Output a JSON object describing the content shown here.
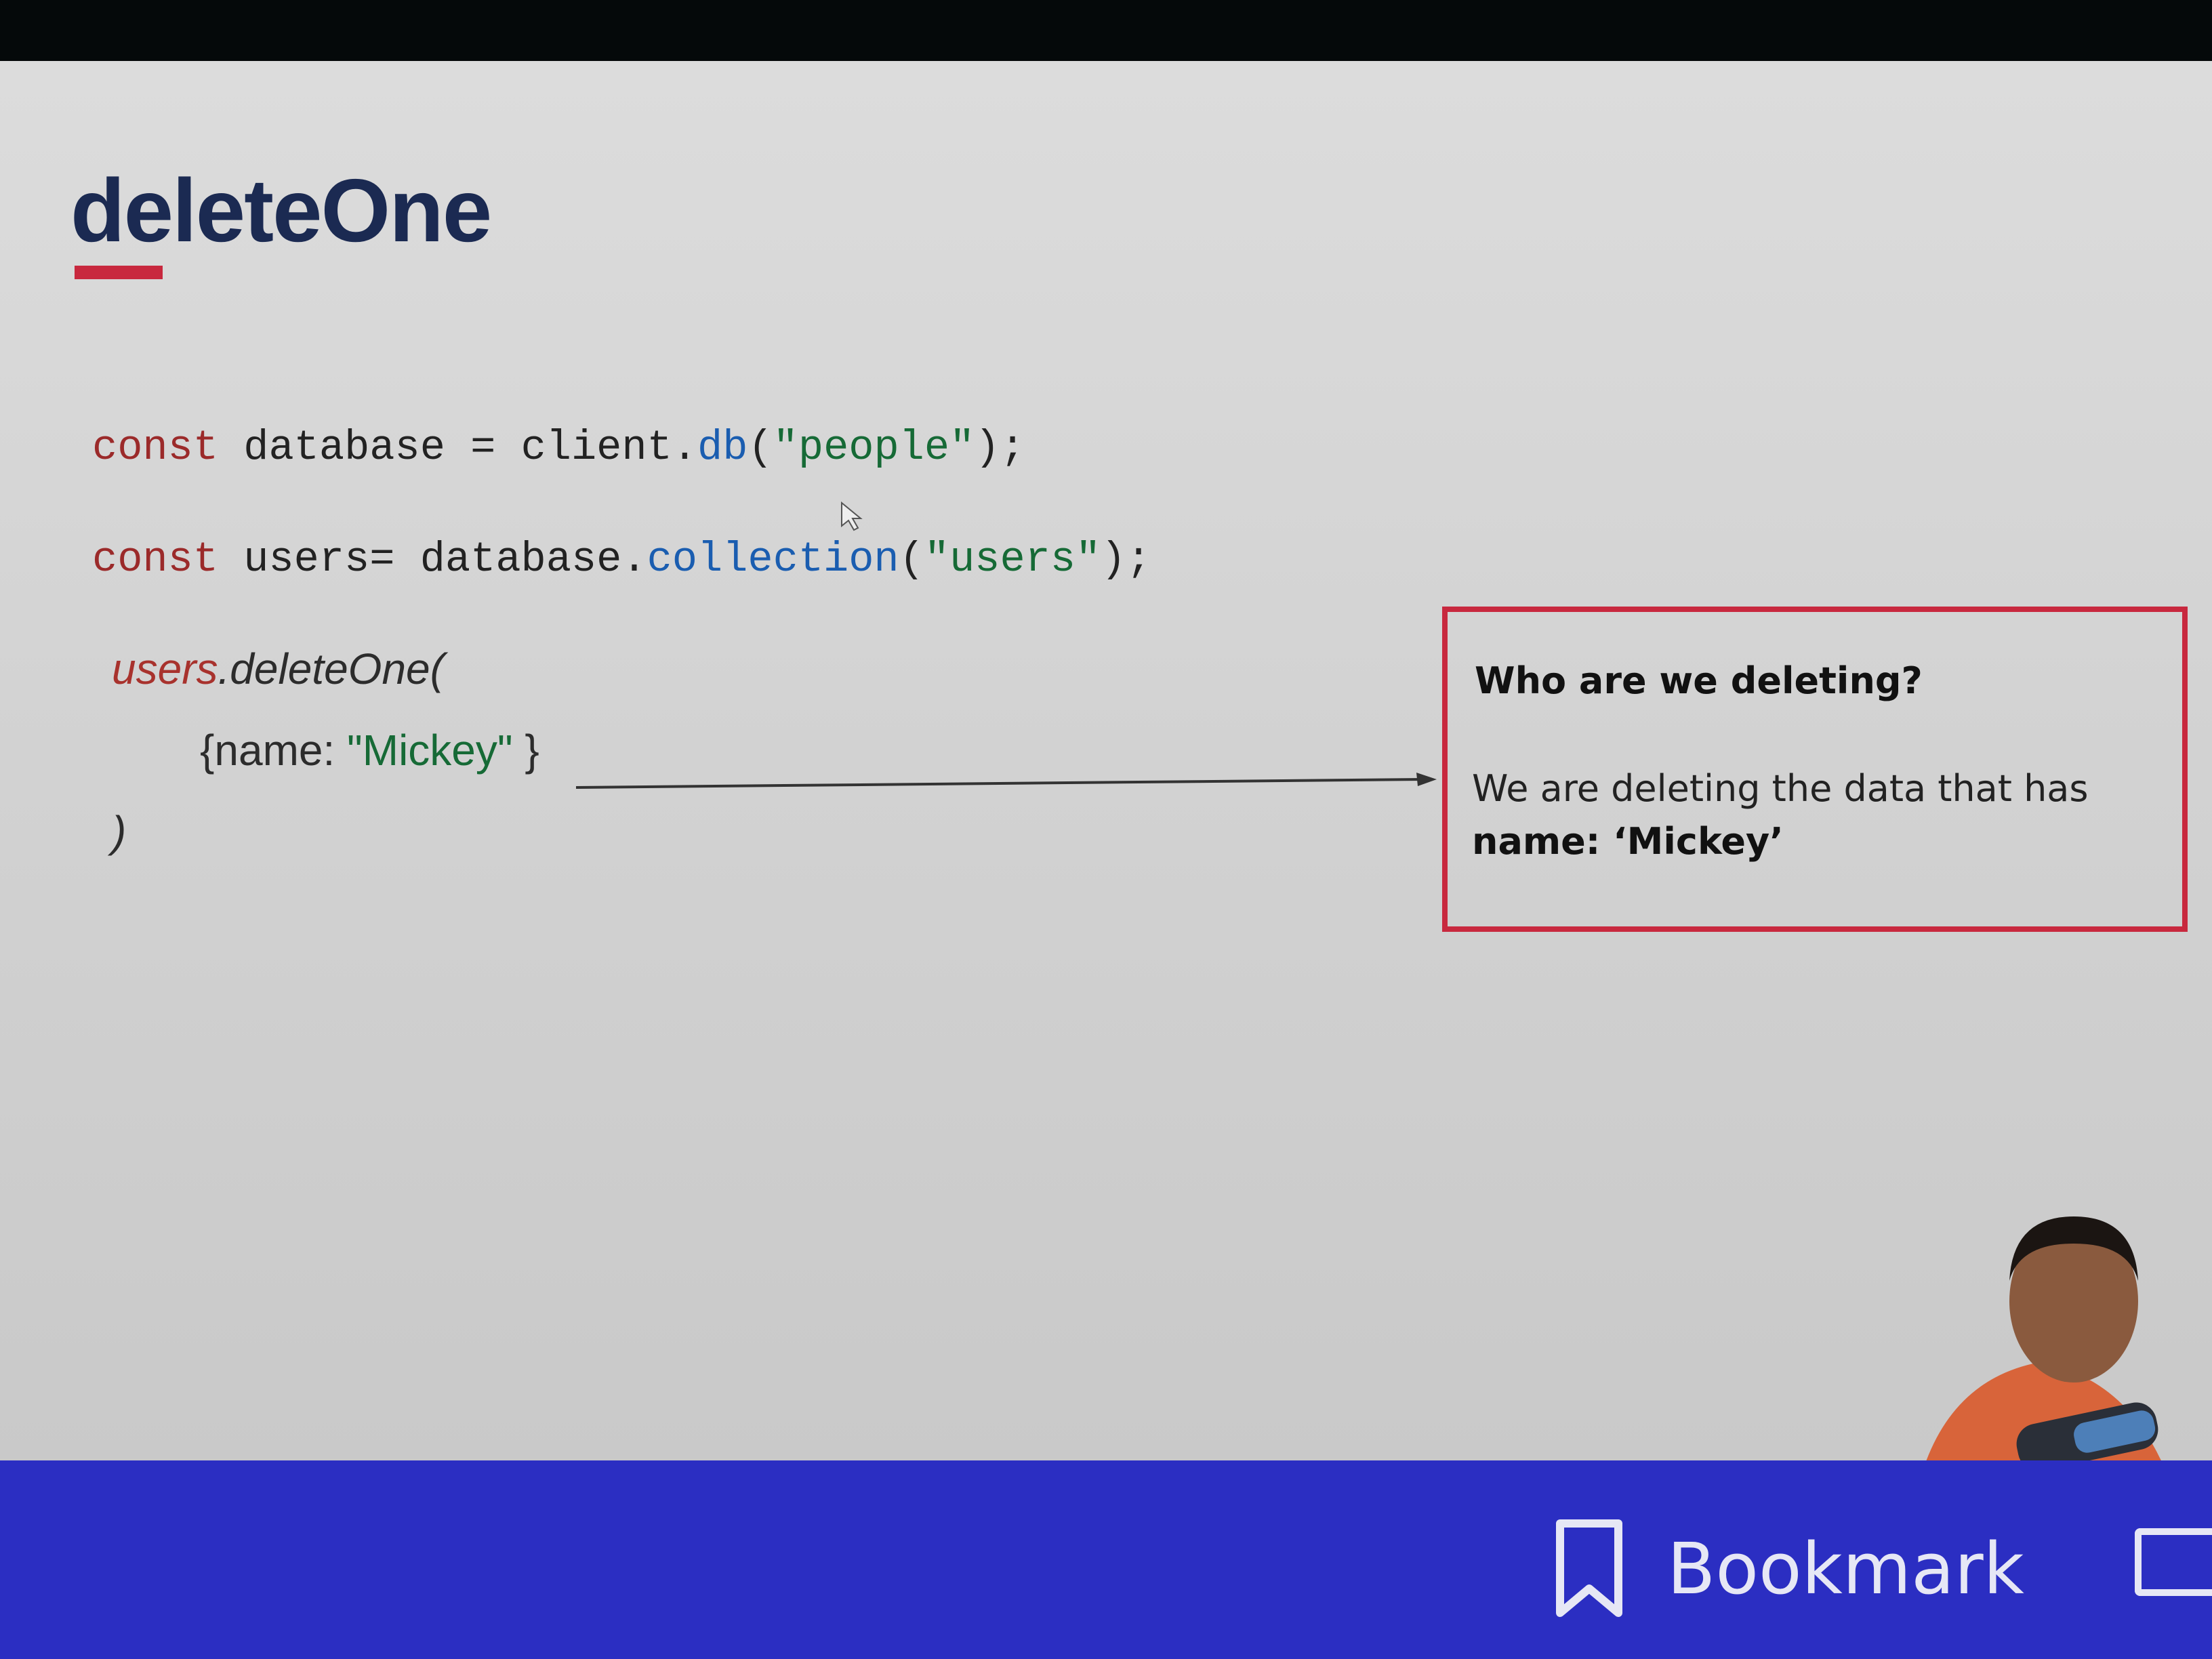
{
  "slide": {
    "title": "deleteOne",
    "code": {
      "line1": {
        "keyword": "const",
        "variable": "database",
        "assign": "=",
        "object": "client.",
        "method": "db",
        "open": "(",
        "arg": "\"people\"",
        "close": ");"
      },
      "line2": {
        "keyword": "const",
        "variable": "users=",
        "object": "database.",
        "method": "collection",
        "open": "(",
        "arg": "\"users\"",
        "close": ");"
      }
    },
    "example": {
      "object": "users",
      "call": ".deleteOne(",
      "filter_open": "{name: ",
      "filter_value": "\"Mickey\"",
      "filter_close": " }",
      "close_paren": ")"
    },
    "note": {
      "heading": "Who are we deleting?",
      "body": "We are deleting the data that has",
      "body_emphasis": "name: ‘Mickey’"
    }
  },
  "toolbar": {
    "bookmark_label": "Bookmark",
    "bookmark_icon": "bookmark-icon"
  },
  "colors": {
    "title": "#1b2a52",
    "accent": "#c8283e",
    "bottom_bar": "#2b2ec2"
  }
}
